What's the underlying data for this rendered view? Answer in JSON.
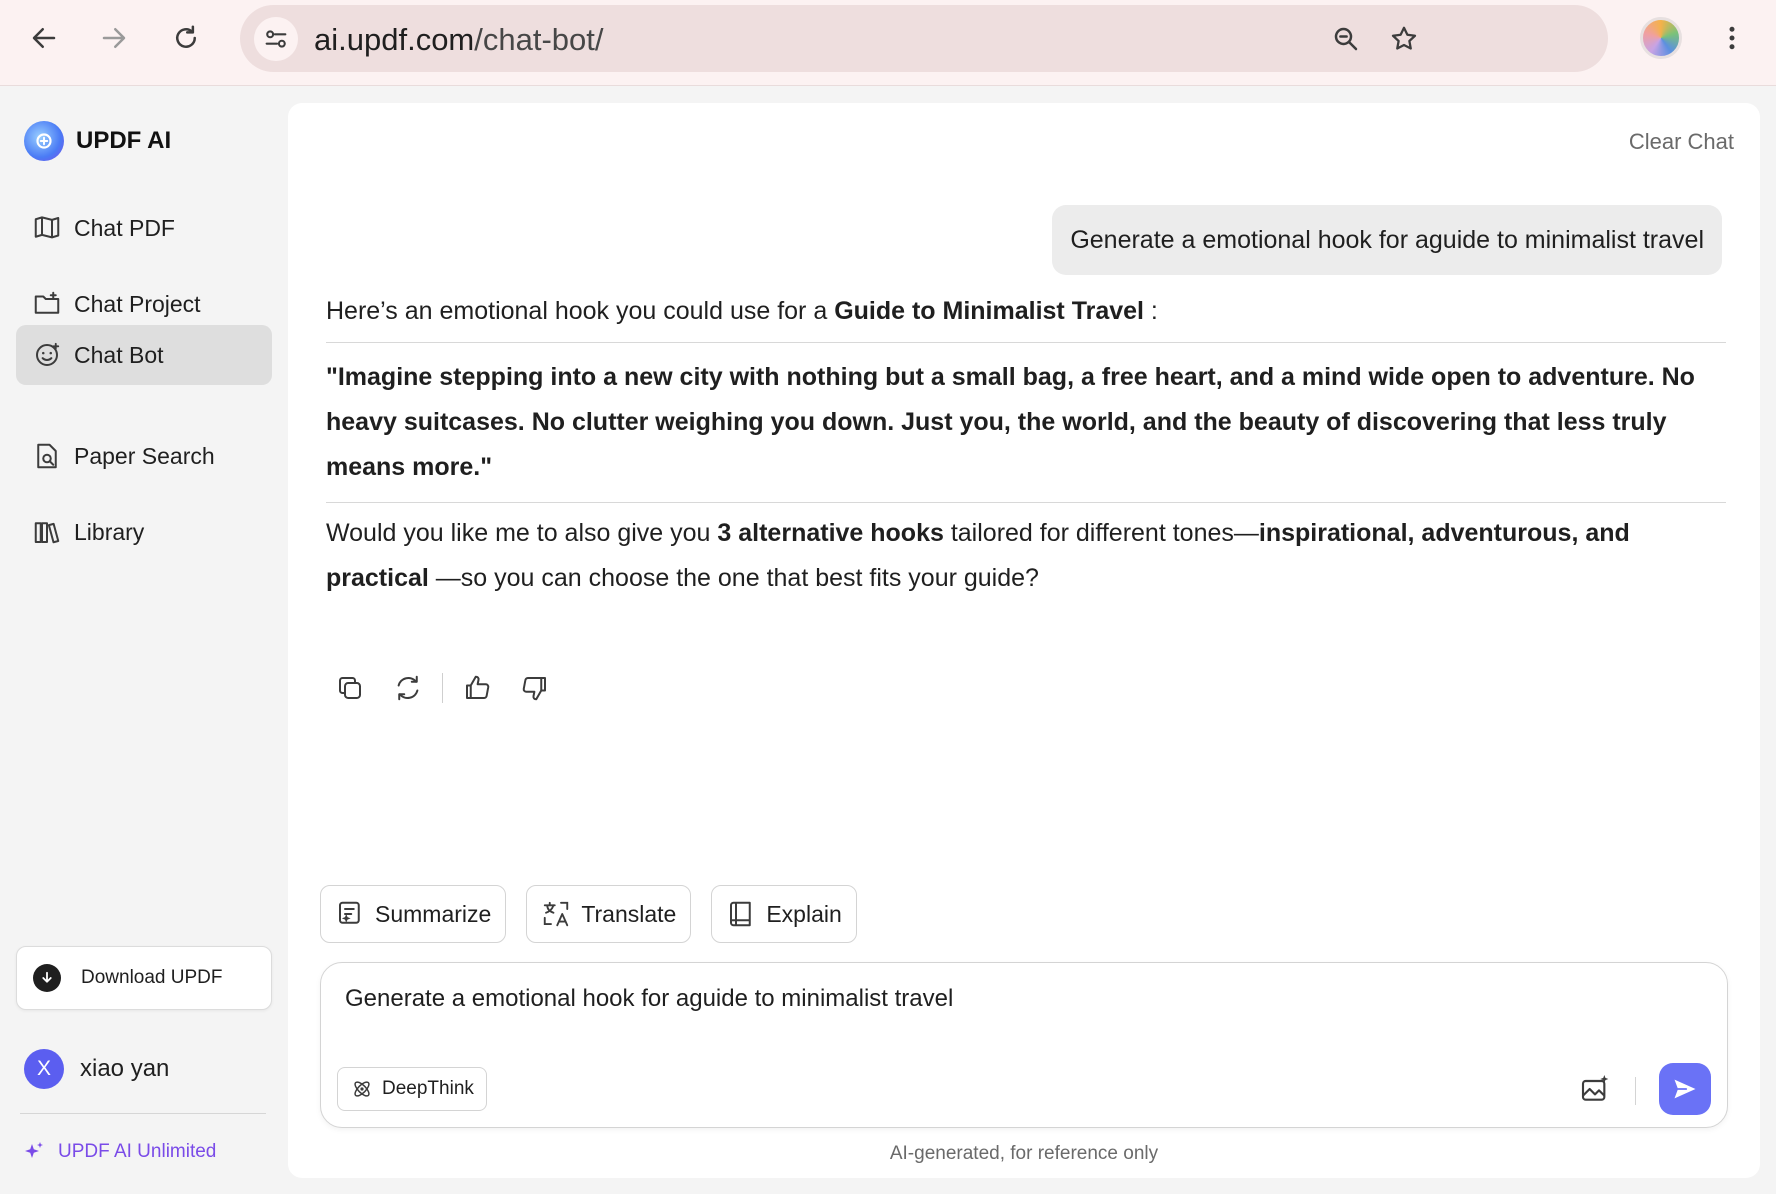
{
  "browser": {
    "url_domain": "ai.updf.com",
    "url_path": "/chat-bot/"
  },
  "sidebar": {
    "brand": "UPDF AI",
    "items": [
      {
        "label": "Chat PDF",
        "icon": "book-open-icon"
      },
      {
        "label": "Chat Project",
        "icon": "folder-chat-icon"
      },
      {
        "label": "Chat Bot",
        "icon": "bot-icon",
        "active": true
      },
      {
        "label": "Paper Search",
        "icon": "search-document-icon"
      },
      {
        "label": "Library",
        "icon": "library-icon"
      }
    ],
    "download_label": "Download UPDF",
    "user_initial": "X",
    "user_name": "xiao yan",
    "unlimited_label": "UPDF AI Unlimited"
  },
  "chat": {
    "clear_label": "Clear Chat",
    "user_message": "Generate a emotional hook for aguide to minimalist travel",
    "answer": {
      "intro_plain": "Here’s an emotional hook you could use for a ",
      "intro_bold": "Guide to Minimalist Travel",
      "intro_end": " :",
      "quote": "\"Imagine stepping into a new city with nothing but a small bag, a free heart, and a mind wide open to adventure. No heavy suitcases. No clutter weighing you down. Just you, the world, and the beauty of discovering that less truly means more.\"",
      "follow_1": "Would you like me to also give you ",
      "follow_bold_1": "3 alternative hooks",
      "follow_2": " tailored for different tones—",
      "follow_bold_2": "inspirational, adventurous, and practical",
      "follow_3": " —so you can choose the one that best fits your guide?"
    }
  },
  "quick_actions": {
    "summarize": "Summarize",
    "translate": "Translate",
    "explain": "Explain"
  },
  "composer": {
    "value": "Generate a emotional hook for aguide to minimalist travel",
    "deepthink_label": "DeepThink",
    "disclaimer": "AI-generated, for reference only"
  },
  "colors": {
    "accent": "#6a72f6",
    "brand_purple": "#7a4be8",
    "active_item": "#dedede"
  }
}
